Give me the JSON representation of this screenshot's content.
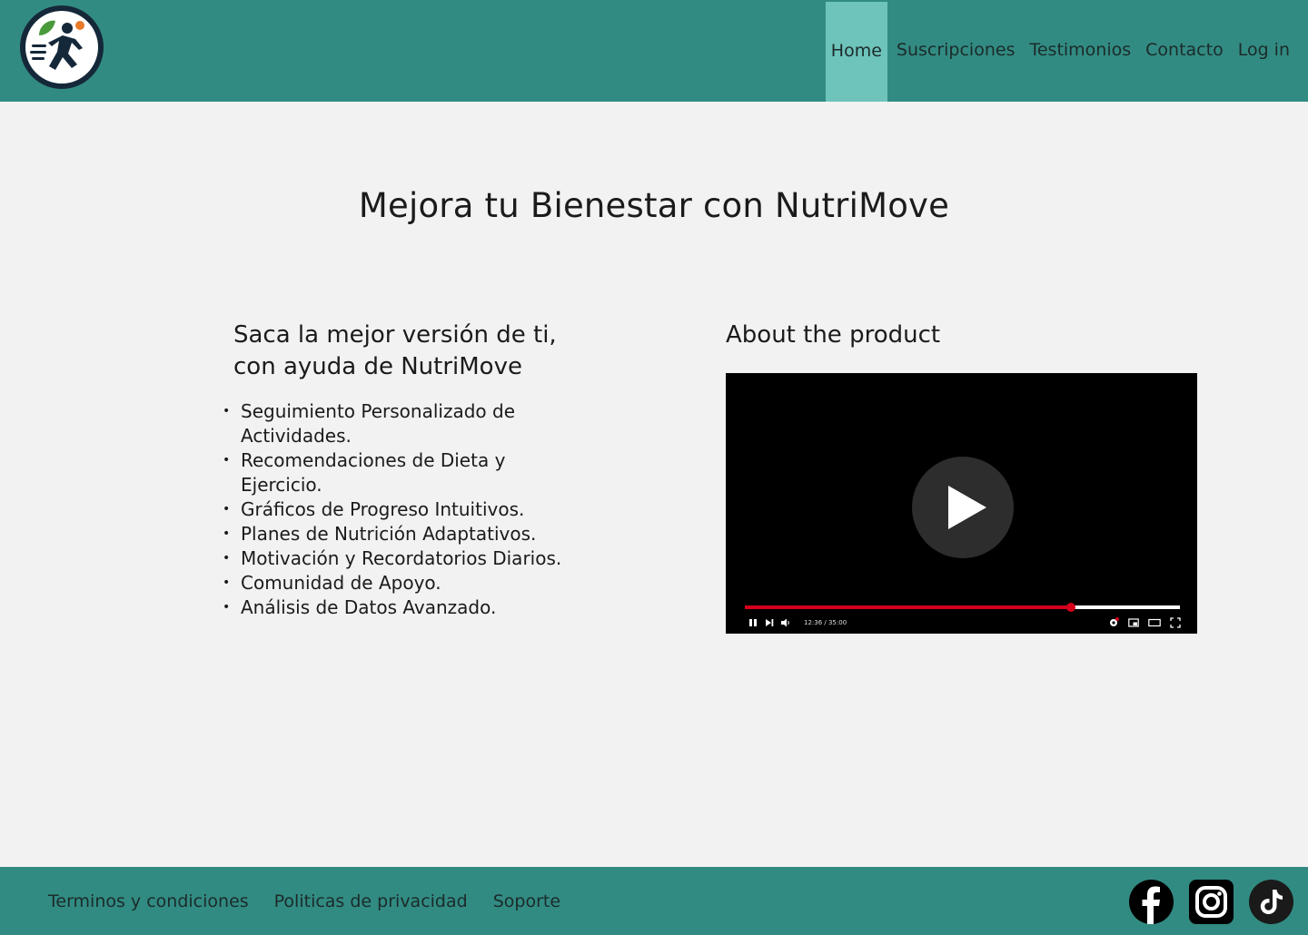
{
  "header": {
    "logo_alt": "NutriMove logo",
    "nav": [
      {
        "label": "Home",
        "active": true
      },
      {
        "label": "Suscripciones",
        "active": false
      },
      {
        "label": "Testimonios",
        "active": false
      },
      {
        "label": "Contacto",
        "active": false
      },
      {
        "label": "Log in",
        "active": false
      }
    ]
  },
  "main": {
    "title": "Mejora tu Bienestar con NutriMove",
    "left": {
      "heading": "Saca la mejor versión de ti, con ayuda de NutriMove",
      "features": [
        "Seguimiento Personalizado de Actividades.",
        "Recomendaciones de Dieta y Ejercicio.",
        "Gráficos de Progreso Intuitivos.",
        "Planes de Nutrición Adaptativos.",
        "Motivación y Recordatorios Diarios.",
        "Comunidad de Apoyo.",
        "Análisis de Datos Avanzado."
      ]
    },
    "right": {
      "heading": "About the product",
      "video": {
        "time": "12:36 / 35:00",
        "progress": 0.75
      }
    }
  },
  "footer": {
    "links": [
      "Terminos y condiciones",
      "Politicas de privacidad",
      "Soporte"
    ],
    "social": [
      "facebook-icon",
      "instagram-icon",
      "tiktok-icon"
    ]
  },
  "colors": {
    "header_bg": "#328b82",
    "nav_active_bg": "#6ec3bb",
    "page_bg": "#f2f2f2",
    "progress_played": "#d6001c"
  }
}
